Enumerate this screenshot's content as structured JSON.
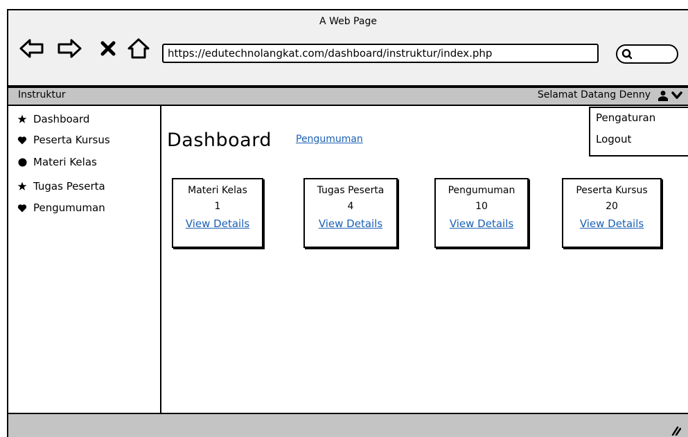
{
  "window": {
    "title": "A Web Page"
  },
  "toolbar": {
    "back_icon": "back-arrow-icon",
    "forward_icon": "forward-arrow-icon",
    "stop_icon": "close-icon",
    "home_icon": "home-icon",
    "url": "https://edutechnolangkat.com/dashboard/instruktur/index.php"
  },
  "menubar": {
    "app_name": "Instruktur",
    "greeting": "Selamat Datang Denny"
  },
  "dropdown": {
    "items": [
      {
        "label": "Pengaturan"
      },
      {
        "label": "Logout"
      }
    ]
  },
  "sidebar": {
    "items": [
      {
        "label": "Dashboard",
        "icon": "star-icon"
      },
      {
        "label": "Peserta Kursus",
        "icon": "heart-icon"
      },
      {
        "label": "Materi Kelas",
        "icon": "circle-icon"
      },
      {
        "label": "Tugas Peserta",
        "icon": "star-icon"
      },
      {
        "label": "Pengumuman",
        "icon": "heart-icon"
      }
    ]
  },
  "main": {
    "title": "Dashboard",
    "title_link": "Pengumuman",
    "cards": [
      {
        "title": "Materi Kelas",
        "value": "1",
        "link": "View Details"
      },
      {
        "title": "Tugas Peserta",
        "value": "4",
        "link": "View Details"
      },
      {
        "title": "Pengumuman",
        "value": "10",
        "link": "View Details"
      },
      {
        "title": "Peserta Kursus",
        "value": "20",
        "link": "View Details"
      }
    ]
  },
  "colors": {
    "link": "#1a5fb4",
    "chrome": "#c4c4c4",
    "window_bg": "#f0f0f0"
  }
}
